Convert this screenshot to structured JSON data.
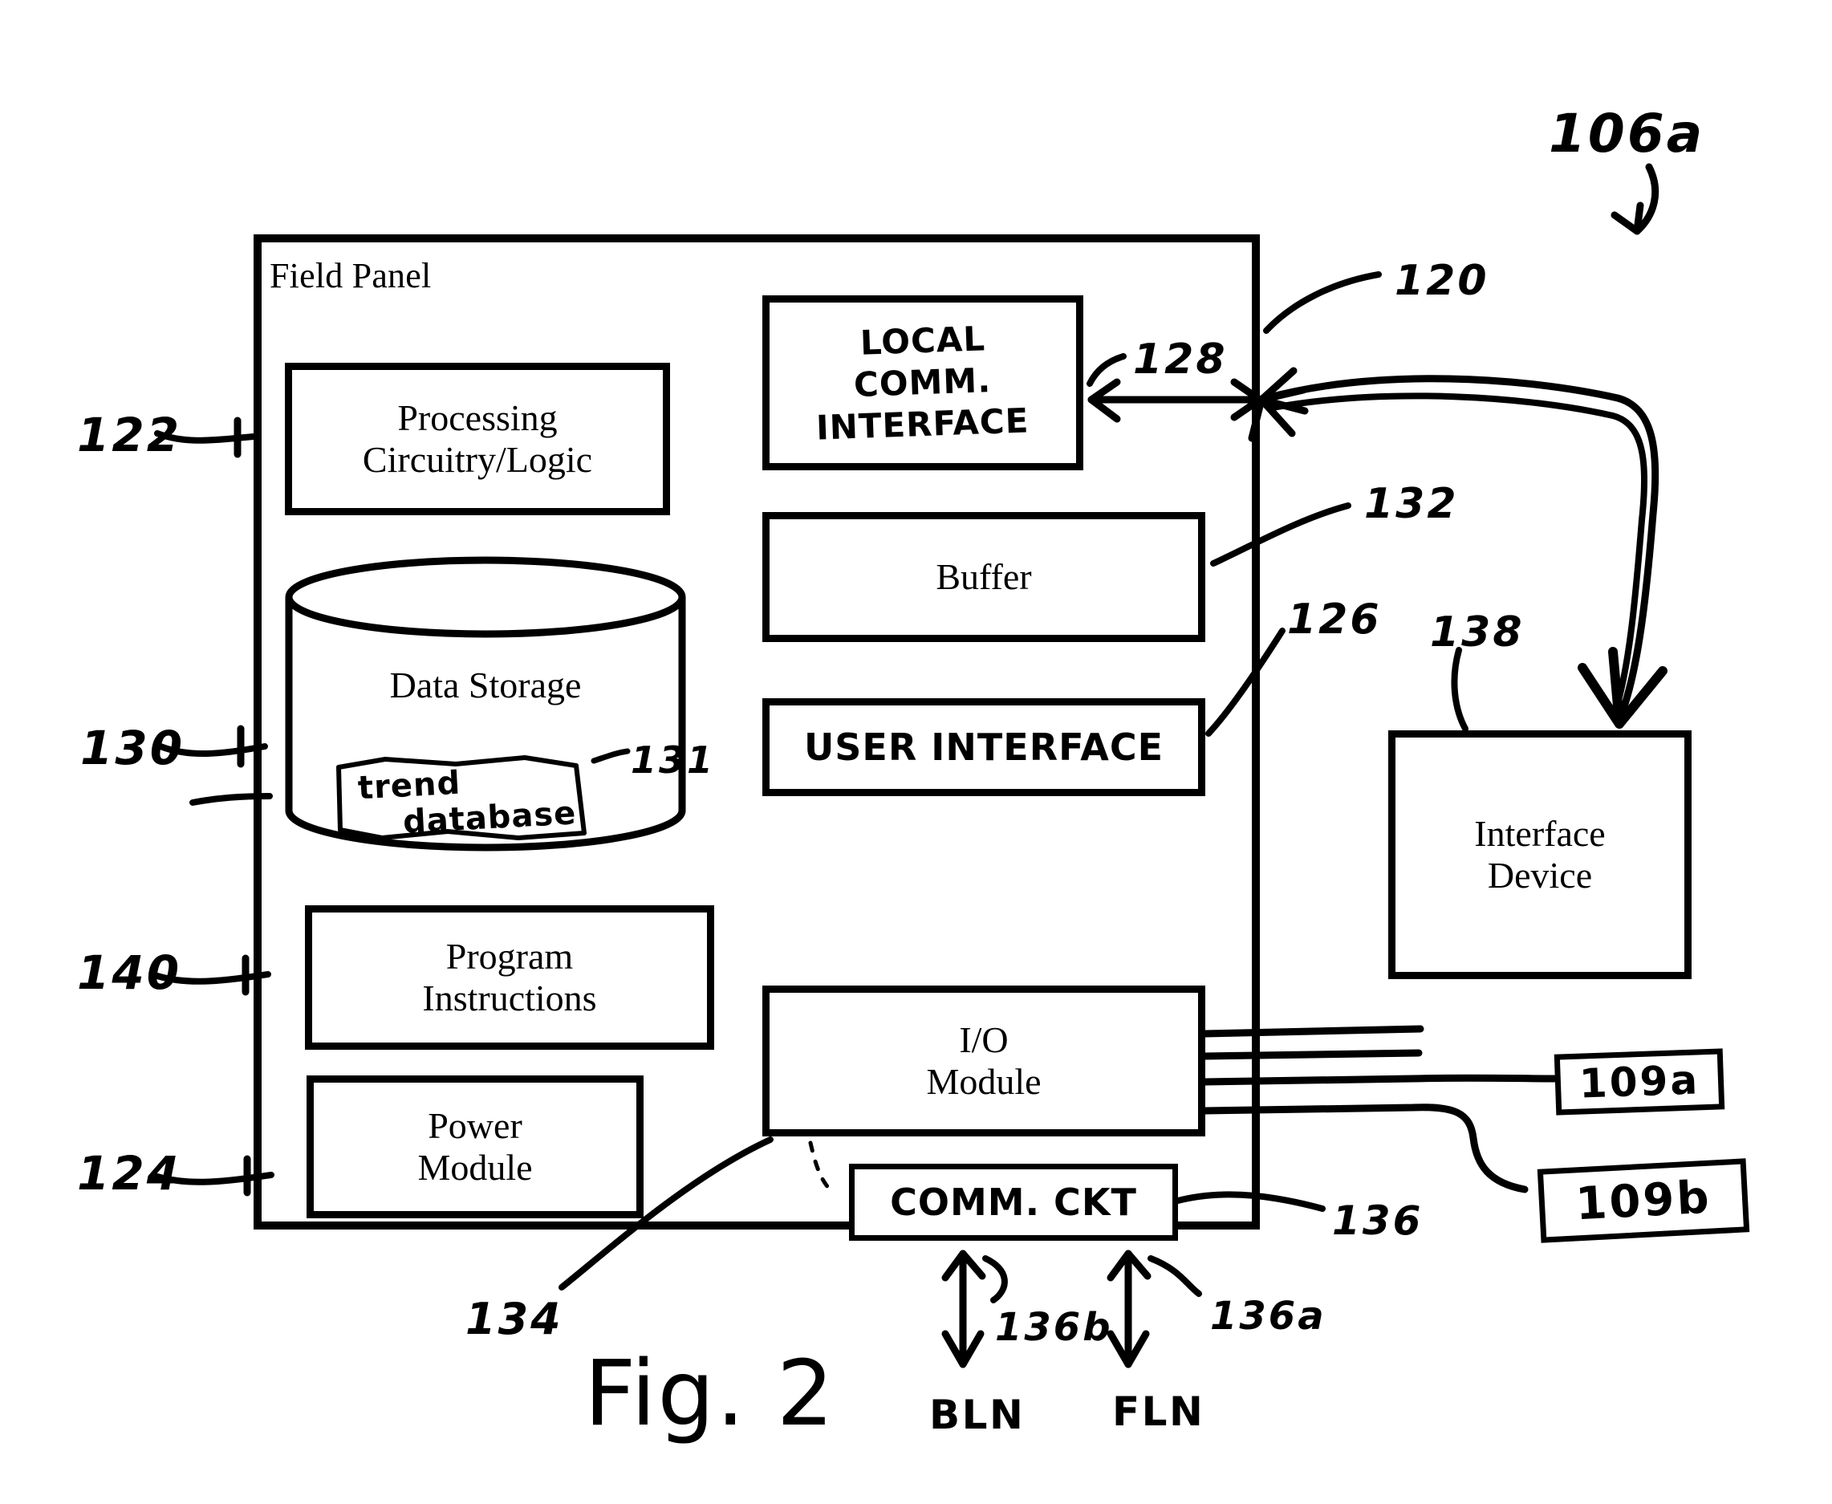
{
  "figure": {
    "caption": "Fig. 2",
    "top_reference": "106a"
  },
  "field_panel": {
    "title": "Field Panel",
    "reference_numbers": {
      "processing": "122",
      "data_storage": "130",
      "trend_database": "131",
      "program_instructions": "140",
      "power_module": "124",
      "local_comm_interface": "128",
      "buffer": "132",
      "user_interface": "126",
      "io_module": "134",
      "comm_ckt": "136",
      "bln_link": "136b",
      "fln_link": "136a",
      "panel_link": "120",
      "interface_device": "138"
    },
    "blocks": [
      {
        "name": "processing-circuitry-logic",
        "line1": "Processing",
        "line2": "Circuitry/Logic"
      },
      {
        "name": "data-storage",
        "line1": "Data Storage",
        "line2": ""
      },
      {
        "name": "program-instructions",
        "line1": "Program",
        "line2": "Instructions"
      },
      {
        "name": "power-module",
        "line1": "Power",
        "line2": "Module"
      },
      {
        "name": "io-module",
        "line1": "I/O",
        "line2": "Module"
      },
      {
        "name": "buffer",
        "line1": "Buffer",
        "line2": ""
      }
    ],
    "handwritten_blocks": [
      {
        "name": "local-comm-interface",
        "line1": "LOCAL",
        "line2": "COMM.",
        "line3": "INTERFACE"
      },
      {
        "name": "user-interface",
        "line1": "USER INTERFACE"
      },
      {
        "name": "comm-ckt",
        "line1": "COMM. CKT"
      },
      {
        "name": "trend-database",
        "line1": "trend",
        "line2": "database"
      }
    ]
  },
  "external": {
    "interface_device": {
      "line1": "Interface",
      "line2": "Device"
    },
    "device_109a": "109a",
    "device_109b": "109b",
    "network_bln": "BLN",
    "network_fln": "FLN"
  },
  "colors": {
    "ink": "#000000",
    "paper": "#ffffff"
  }
}
